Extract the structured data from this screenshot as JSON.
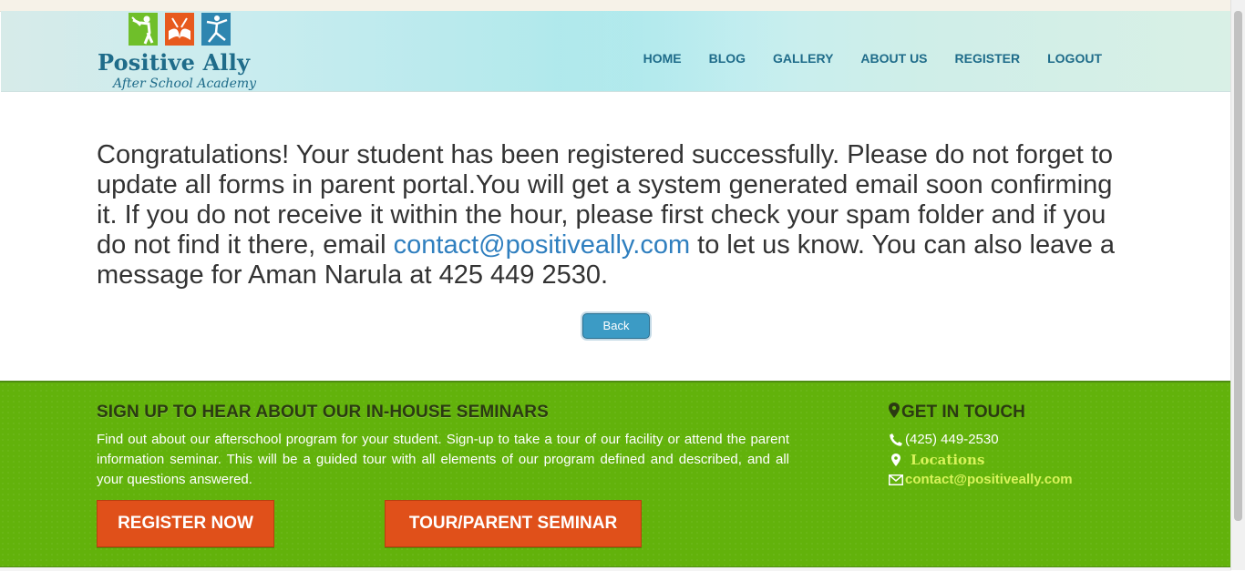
{
  "header": {
    "logo_title": "Positive Ally",
    "logo_subtitle": "After School Academy",
    "nav": [
      "HOME",
      "BLOG",
      "GALLERY",
      "ABOUT US",
      "REGISTER",
      "LOGOUT"
    ]
  },
  "main": {
    "message_before_link": "Congratulations! Your student has been registered successfully. Please do not forget to update all forms in parent portal.You will get a system generated email soon confirming it. If you do not receive it within the hour, please first check your spam folder and if you do not find it there, email ",
    "email_link": "contact@positiveally.com",
    "message_after_link": " to let us know. You can also leave a message for Aman Narula at 425 449 2530.",
    "back_button": "Back"
  },
  "footer": {
    "seminar_title": "SIGN UP TO HEAR ABOUT OUR IN-HOUSE SEMINARS",
    "seminar_text": "Find out about our afterschool program for your student. Sign-up to take a tour of our facility or attend the parent information seminar. This will be a guided tour with all elements of our program defined and described, and all your questions answered.",
    "register_button": "REGISTER NOW",
    "tour_button": "TOUR/PARENT SEMINAR",
    "contact_title": "GET IN TOUCH",
    "phone": "(425) 449-2530",
    "locations": "Locations",
    "email": "contact@positiveally.com"
  },
  "colors": {
    "brand_blue": "#1f6c8a",
    "footer_green": "#62b20b",
    "button_orange": "#e0501a",
    "link_blue": "#2f7fbf",
    "accent_yellow": "#d8f35b"
  },
  "icons": {
    "logo": [
      "batter-icon",
      "book-icon",
      "dancer-icon"
    ],
    "contact": [
      "map-marker-icon",
      "phone-icon",
      "location-pin-icon",
      "envelope-icon"
    ]
  }
}
